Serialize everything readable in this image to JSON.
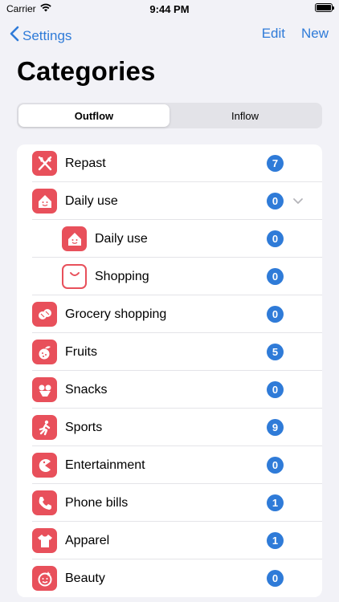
{
  "status": {
    "carrier": "Carrier",
    "time": "9:44 PM"
  },
  "nav": {
    "back_label": "Settings",
    "edit_label": "Edit",
    "new_label": "New"
  },
  "title": "Categories",
  "segments": [
    {
      "label": "Outflow",
      "active": true
    },
    {
      "label": "Inflow",
      "active": false
    }
  ],
  "colors": {
    "accent": "#2F7BD8",
    "icon": "#E8505B",
    "background": "#F2F2F7"
  },
  "categories": [
    {
      "label": "Repast",
      "count": "7",
      "icon": "fork-knife-icon"
    },
    {
      "label": "Daily use",
      "count": "0",
      "icon": "house-icon",
      "expanded": true
    },
    {
      "label": "Daily use",
      "count": "0",
      "icon": "house-icon",
      "child": true
    },
    {
      "label": "Shopping",
      "count": "0",
      "icon": "shopping-bag-icon",
      "child": true
    },
    {
      "label": "Grocery shopping",
      "count": "0",
      "icon": "vegetables-icon"
    },
    {
      "label": "Fruits",
      "count": "5",
      "icon": "fruit-icon"
    },
    {
      "label": "Snacks",
      "count": "0",
      "icon": "snack-icon"
    },
    {
      "label": "Sports",
      "count": "9",
      "icon": "runner-icon"
    },
    {
      "label": "Entertainment",
      "count": "0",
      "icon": "pacman-icon"
    },
    {
      "label": "Phone bills",
      "count": "1",
      "icon": "phone-icon"
    },
    {
      "label": "Apparel",
      "count": "1",
      "icon": "tshirt-icon"
    },
    {
      "label": "Beauty",
      "count": "0",
      "icon": "face-icon"
    }
  ]
}
